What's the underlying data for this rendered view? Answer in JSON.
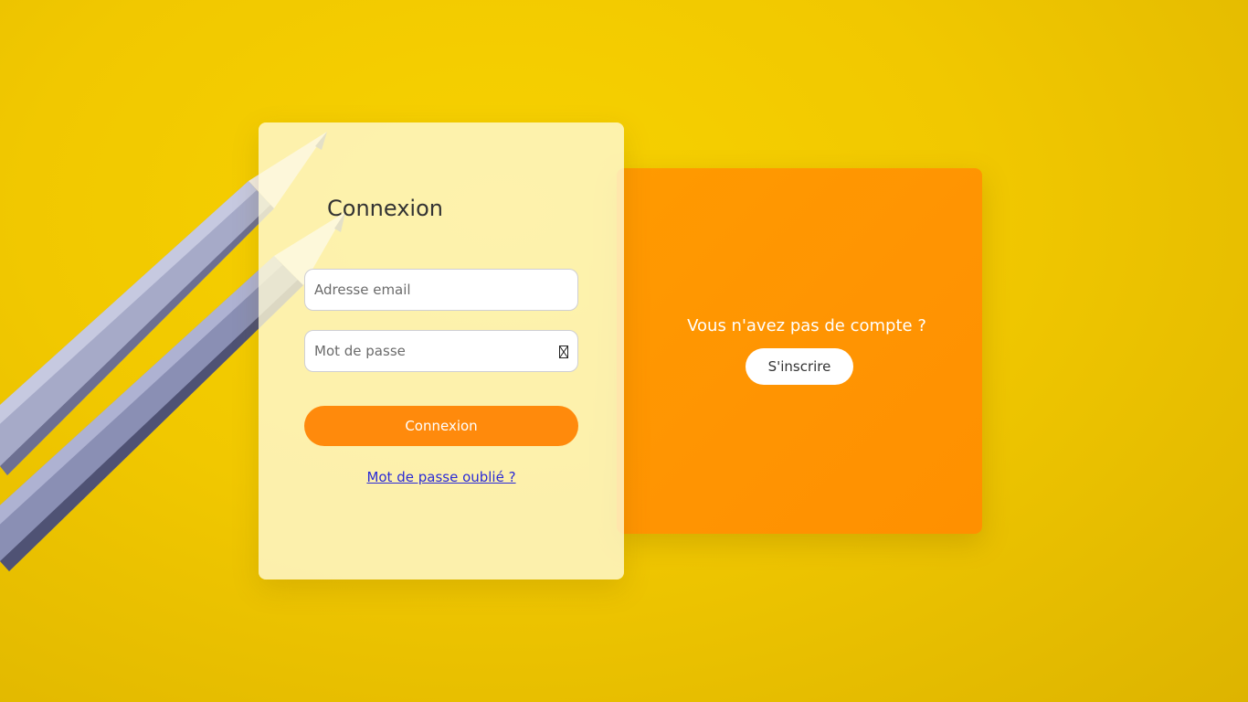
{
  "login": {
    "title": "Connexion",
    "email_placeholder": "Adresse email",
    "password_placeholder": "Mot de passe",
    "submit_label": "Connexion",
    "forgot_label": "Mot de passe oublié ?"
  },
  "signup": {
    "question": "Vous n'avez pas de compte ?",
    "button_label": "S'inscrire"
  },
  "icons": {
    "password_toggle": "password-visibility-icon"
  },
  "colors": {
    "background": "#f4cd00",
    "primary_orange": "#ff8a0c",
    "signup_panel": "#ff9400",
    "link": "#2b2bd6",
    "card": "#fffad7"
  }
}
